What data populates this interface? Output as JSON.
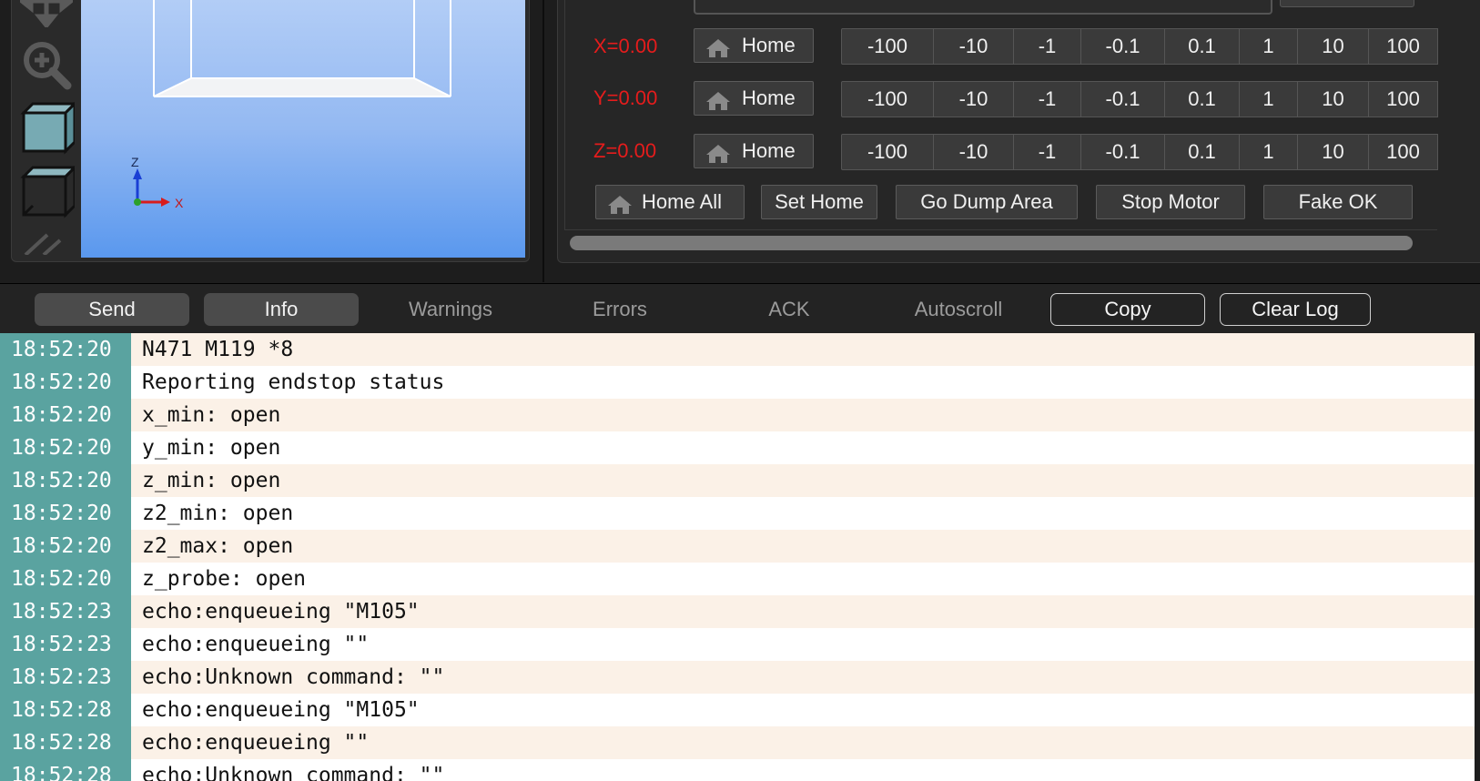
{
  "toolbar": {
    "tools": [
      "move-icon",
      "zoom-in-icon",
      "solid-view-icon",
      "wireframe-view-icon",
      "slash-icon"
    ]
  },
  "viewport": {
    "axis_z": "Z",
    "axis_x": "X",
    "background_top": "#b2cdf6",
    "background_bottom": "#5a98ee"
  },
  "manual_control": {
    "axes": [
      {
        "label": "X=0.00",
        "home_label": "Home"
      },
      {
        "label": "Y=0.00",
        "home_label": "Home"
      },
      {
        "label": "Z=0.00",
        "home_label": "Home"
      }
    ],
    "steps": [
      "-100",
      "-10",
      "-1",
      "-0.1",
      "0.1",
      "1",
      "10",
      "100"
    ],
    "buttons": {
      "home_all": "Home All",
      "set_home": "Set Home",
      "go_dump_area": "Go Dump Area",
      "stop_motor": "Stop Motor",
      "fake_ok": "Fake OK"
    },
    "axis_color": "#e51c1c"
  },
  "log_tabs": {
    "send": "Send",
    "info": "Info",
    "warnings": "Warnings",
    "errors": "Errors",
    "ack": "ACK",
    "autoscroll": "Autoscroll",
    "copy": "Copy",
    "clear_log": "Clear Log"
  },
  "log": {
    "timestamp_color": "#5aa3a0",
    "entries": [
      {
        "time": "18:52:20",
        "msg": "N471 M119 *8"
      },
      {
        "time": "18:52:20",
        "msg": "Reporting endstop status"
      },
      {
        "time": "18:52:20",
        "msg": "x_min: open"
      },
      {
        "time": "18:52:20",
        "msg": "y_min: open"
      },
      {
        "time": "18:52:20",
        "msg": "z_min: open"
      },
      {
        "time": "18:52:20",
        "msg": "z2_min: open"
      },
      {
        "time": "18:52:20",
        "msg": "z2_max: open"
      },
      {
        "time": "18:52:20",
        "msg": "z_probe: open"
      },
      {
        "time": "18:52:23",
        "msg": "echo:enqueueing \"M105\""
      },
      {
        "time": "18:52:23",
        "msg": "echo:enqueueing \"\""
      },
      {
        "time": "18:52:23",
        "msg": "echo:Unknown command: \"\""
      },
      {
        "time": "18:52:28",
        "msg": "echo:enqueueing \"M105\""
      },
      {
        "time": "18:52:28",
        "msg": "echo:enqueueing \"\""
      },
      {
        "time": "18:52:28",
        "msg": "echo:Unknown command: \"\""
      }
    ]
  }
}
